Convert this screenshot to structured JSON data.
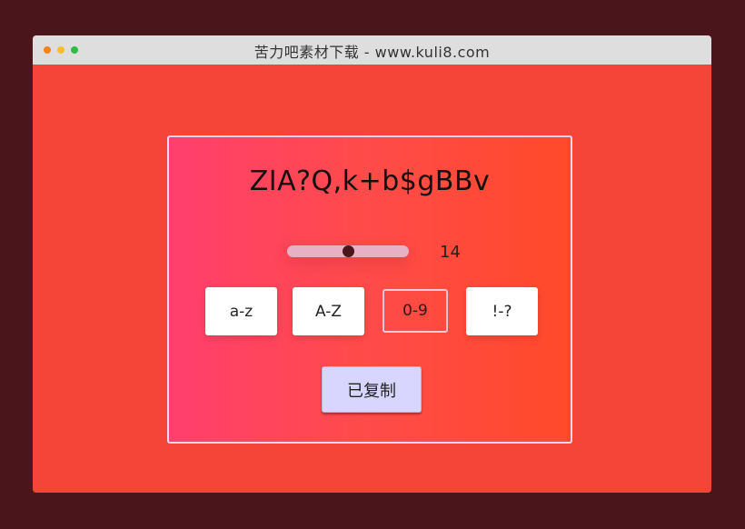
{
  "window": {
    "title": "苦力吧素材下载 - www.kuli8.com",
    "dot_colors": [
      "#ff5f57",
      "#febc2e",
      "#28c840"
    ]
  },
  "generator": {
    "password": "ZIA?Q,k+b$gBBv",
    "length_value": "14",
    "slider_fraction": 0.5,
    "options": [
      {
        "label": "a-z",
        "enabled": true
      },
      {
        "label": "A-Z",
        "enabled": true
      },
      {
        "label": "0-9",
        "enabled": false
      },
      {
        "label": "!-?",
        "enabled": true
      }
    ],
    "copy_label": "已复制"
  },
  "colors": {
    "background": "#4a161b",
    "window_bg": "#f54538",
    "panel_gradient_start": "#ff3f6e",
    "panel_gradient_end": "#ff4a2a",
    "copy_button_bg": "#d8d5ff",
    "slider_track": "#e7b0c5",
    "slider_knob": "#4a161b"
  }
}
